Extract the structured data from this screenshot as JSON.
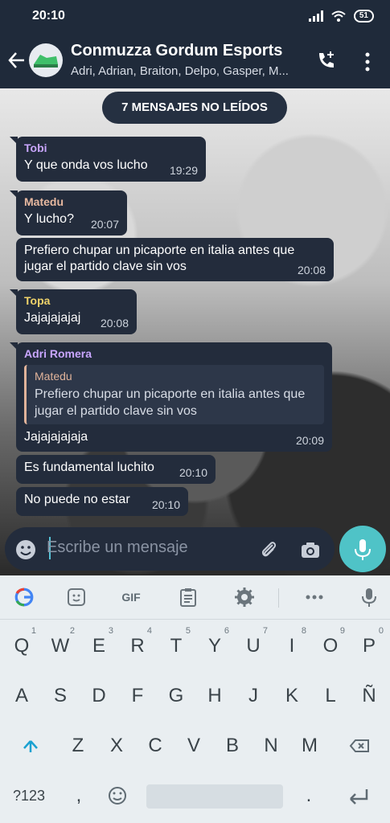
{
  "status_bar": {
    "time": "20:10",
    "battery": "51"
  },
  "chat_header": {
    "title": "Conmuzza Gordum Esports",
    "subtitle": "Adri, Adrian, Braiton, Delpo, Gasper, M..."
  },
  "unread_banner": "7 MENSAJES NO LEÍDOS",
  "messages": [
    {
      "sender": "Tobi",
      "sender_color": "#c9a6ff",
      "text": "Y que onda vos lucho",
      "time": "19:29"
    },
    {
      "sender": "Matedu",
      "sender_color": "#e8b9a0",
      "text": "Y lucho?",
      "time": "20:07"
    },
    {
      "sender": "",
      "text": "Prefiero chupar un picaporte en italia antes que jugar el partido clave sin vos",
      "time": "20:08"
    },
    {
      "sender": "Topa",
      "sender_color": "#f0d36a",
      "text": "Jajajajajaj",
      "time": "20:08"
    },
    {
      "sender": "Adri Romera",
      "sender_color": "#c9a6ff",
      "reply": {
        "sender": "Matedu",
        "text": "Prefiero chupar un picaporte en italia antes que jugar el partido clave sin vos"
      },
      "text": "Jajajajajaja",
      "time": "20:09"
    },
    {
      "sender": "",
      "text": "Es fundamental luchito",
      "time": "20:10"
    },
    {
      "sender": "",
      "text": "No puede no estar",
      "time": "20:10"
    }
  ],
  "composer": {
    "placeholder": "Escribe un mensaje"
  },
  "keyboard": {
    "toolbar": {
      "gif": "GIF"
    },
    "row1": [
      {
        "key": "Q",
        "hint": "1"
      },
      {
        "key": "W",
        "hint": "2"
      },
      {
        "key": "E",
        "hint": "3"
      },
      {
        "key": "R",
        "hint": "4"
      },
      {
        "key": "T",
        "hint": "5"
      },
      {
        "key": "Y",
        "hint": "6"
      },
      {
        "key": "U",
        "hint": "7"
      },
      {
        "key": "I",
        "hint": "8"
      },
      {
        "key": "O",
        "hint": "9"
      },
      {
        "key": "P",
        "hint": "0"
      }
    ],
    "row2": [
      "A",
      "S",
      "D",
      "F",
      "G",
      "H",
      "J",
      "K",
      "L",
      "Ñ"
    ],
    "row3": [
      "Z",
      "X",
      "C",
      "V",
      "B",
      "N",
      "M"
    ],
    "row4": {
      "symbols": "?123",
      "comma": ",",
      "period": "."
    }
  },
  "colors": {
    "accent": "#4fc3c7",
    "bubble": "#232c3c",
    "header": "#1f2a3a"
  }
}
